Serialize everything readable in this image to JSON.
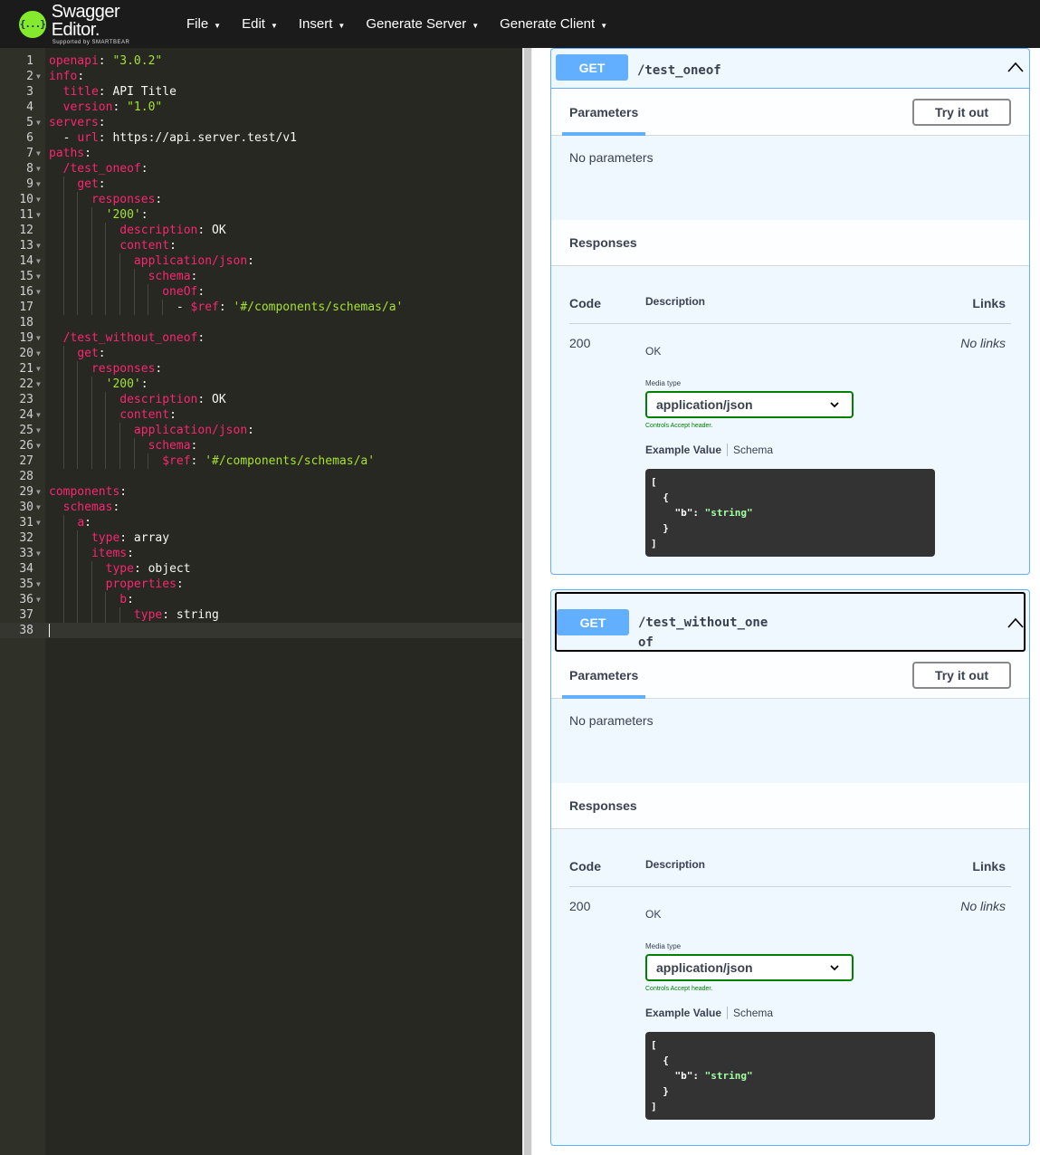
{
  "app": {
    "logo_title": "Swagger Editor.",
    "logo_subtitle": "Supported by SMARTBEAR",
    "logo_badge": "{...}"
  },
  "menu": [
    {
      "label": "File"
    },
    {
      "label": "Edit"
    },
    {
      "label": "Insert"
    },
    {
      "label": "Generate Server"
    },
    {
      "label": "Generate Client"
    }
  ],
  "editor": {
    "lines": [
      {
        "n": "1",
        "fold": false,
        "tokens": [
          [
            "k",
            "openapi"
          ],
          [
            "c",
            ": "
          ],
          [
            "s",
            "\"3.0.2\""
          ]
        ]
      },
      {
        "n": "2",
        "fold": true,
        "tokens": [
          [
            "k",
            "info"
          ],
          [
            "c",
            ":"
          ]
        ]
      },
      {
        "n": "3",
        "fold": false,
        "tokens": [
          [
            "c",
            "  "
          ],
          [
            "k",
            "title"
          ],
          [
            "c",
            ": API Title"
          ]
        ]
      },
      {
        "n": "4",
        "fold": false,
        "tokens": [
          [
            "c",
            "  "
          ],
          [
            "k",
            "version"
          ],
          [
            "c",
            ": "
          ],
          [
            "s",
            "\"1.0\""
          ]
        ]
      },
      {
        "n": "5",
        "fold": true,
        "tokens": [
          [
            "k",
            "servers"
          ],
          [
            "c",
            ":"
          ]
        ]
      },
      {
        "n": "6",
        "fold": false,
        "tokens": [
          [
            "c",
            "  - "
          ],
          [
            "k",
            "url"
          ],
          [
            "c",
            ": https://api.server.test/v1"
          ]
        ]
      },
      {
        "n": "7",
        "fold": true,
        "tokens": [
          [
            "k",
            "paths"
          ],
          [
            "c",
            ":"
          ]
        ]
      },
      {
        "n": "8",
        "fold": true,
        "tokens": [
          [
            "c",
            "  "
          ],
          [
            "k",
            "/test_oneof"
          ],
          [
            "c",
            ":"
          ]
        ]
      },
      {
        "n": "9",
        "fold": true,
        "tokens": [
          [
            "c",
            "    "
          ],
          [
            "k",
            "get"
          ],
          [
            "c",
            ":"
          ]
        ]
      },
      {
        "n": "10",
        "fold": true,
        "tokens": [
          [
            "c",
            "      "
          ],
          [
            "k",
            "responses"
          ],
          [
            "c",
            ":"
          ]
        ]
      },
      {
        "n": "11",
        "fold": true,
        "tokens": [
          [
            "c",
            "        "
          ],
          [
            "s",
            "'200'"
          ],
          [
            "c",
            ":"
          ]
        ]
      },
      {
        "n": "12",
        "fold": false,
        "tokens": [
          [
            "c",
            "          "
          ],
          [
            "k",
            "description"
          ],
          [
            "c",
            ": OK"
          ]
        ]
      },
      {
        "n": "13",
        "fold": true,
        "tokens": [
          [
            "c",
            "          "
          ],
          [
            "k",
            "content"
          ],
          [
            "c",
            ":"
          ]
        ]
      },
      {
        "n": "14",
        "fold": true,
        "tokens": [
          [
            "c",
            "            "
          ],
          [
            "k",
            "application/json"
          ],
          [
            "c",
            ":"
          ]
        ]
      },
      {
        "n": "15",
        "fold": true,
        "tokens": [
          [
            "c",
            "              "
          ],
          [
            "k",
            "schema"
          ],
          [
            "c",
            ":"
          ]
        ]
      },
      {
        "n": "16",
        "fold": true,
        "tokens": [
          [
            "c",
            "                "
          ],
          [
            "k",
            "oneOf"
          ],
          [
            "c",
            ":"
          ]
        ]
      },
      {
        "n": "17",
        "fold": false,
        "tokens": [
          [
            "c",
            "                  - "
          ],
          [
            "k",
            "$ref"
          ],
          [
            "c",
            ": "
          ],
          [
            "s",
            "'#/components/schemas/a'"
          ]
        ]
      },
      {
        "n": "18",
        "fold": false,
        "tokens": []
      },
      {
        "n": "19",
        "fold": true,
        "tokens": [
          [
            "c",
            "  "
          ],
          [
            "k",
            "/test_without_oneof"
          ],
          [
            "c",
            ":"
          ]
        ]
      },
      {
        "n": "20",
        "fold": true,
        "tokens": [
          [
            "c",
            "    "
          ],
          [
            "k",
            "get"
          ],
          [
            "c",
            ":"
          ]
        ]
      },
      {
        "n": "21",
        "fold": true,
        "tokens": [
          [
            "c",
            "      "
          ],
          [
            "k",
            "responses"
          ],
          [
            "c",
            ":"
          ]
        ]
      },
      {
        "n": "22",
        "fold": true,
        "tokens": [
          [
            "c",
            "        "
          ],
          [
            "s",
            "'200'"
          ],
          [
            "c",
            ":"
          ]
        ]
      },
      {
        "n": "23",
        "fold": false,
        "tokens": [
          [
            "c",
            "          "
          ],
          [
            "k",
            "description"
          ],
          [
            "c",
            ": OK"
          ]
        ]
      },
      {
        "n": "24",
        "fold": true,
        "tokens": [
          [
            "c",
            "          "
          ],
          [
            "k",
            "content"
          ],
          [
            "c",
            ":"
          ]
        ]
      },
      {
        "n": "25",
        "fold": true,
        "tokens": [
          [
            "c",
            "            "
          ],
          [
            "k",
            "application/json"
          ],
          [
            "c",
            ":"
          ]
        ]
      },
      {
        "n": "26",
        "fold": true,
        "tokens": [
          [
            "c",
            "              "
          ],
          [
            "k",
            "schema"
          ],
          [
            "c",
            ":"
          ]
        ]
      },
      {
        "n": "27",
        "fold": false,
        "tokens": [
          [
            "c",
            "                "
          ],
          [
            "k",
            "$ref"
          ],
          [
            "c",
            ": "
          ],
          [
            "s",
            "'#/components/schemas/a'"
          ]
        ]
      },
      {
        "n": "28",
        "fold": false,
        "tokens": []
      },
      {
        "n": "29",
        "fold": true,
        "tokens": [
          [
            "k",
            "components"
          ],
          [
            "c",
            ":"
          ]
        ]
      },
      {
        "n": "30",
        "fold": true,
        "tokens": [
          [
            "c",
            "  "
          ],
          [
            "k",
            "schemas"
          ],
          [
            "c",
            ":"
          ]
        ]
      },
      {
        "n": "31",
        "fold": true,
        "tokens": [
          [
            "c",
            "    "
          ],
          [
            "k",
            "a"
          ],
          [
            "c",
            ":"
          ]
        ]
      },
      {
        "n": "32",
        "fold": false,
        "tokens": [
          [
            "c",
            "      "
          ],
          [
            "k",
            "type"
          ],
          [
            "c",
            ": array"
          ]
        ]
      },
      {
        "n": "33",
        "fold": true,
        "tokens": [
          [
            "c",
            "      "
          ],
          [
            "k",
            "items"
          ],
          [
            "c",
            ":"
          ]
        ]
      },
      {
        "n": "34",
        "fold": false,
        "tokens": [
          [
            "c",
            "        "
          ],
          [
            "k",
            "type"
          ],
          [
            "c",
            ": object"
          ]
        ]
      },
      {
        "n": "35",
        "fold": true,
        "tokens": [
          [
            "c",
            "        "
          ],
          [
            "k",
            "properties"
          ],
          [
            "c",
            ":"
          ]
        ]
      },
      {
        "n": "36",
        "fold": true,
        "tokens": [
          [
            "c",
            "          "
          ],
          [
            "k",
            "b"
          ],
          [
            "c",
            ":"
          ]
        ]
      },
      {
        "n": "37",
        "fold": false,
        "tokens": [
          [
            "c",
            "            "
          ],
          [
            "k",
            "type"
          ],
          [
            "c",
            ": string"
          ]
        ]
      },
      {
        "n": "38",
        "fold": false,
        "tokens": [],
        "active": true
      }
    ]
  },
  "operations": [
    {
      "method": "GET",
      "path": "/test_oneof",
      "parameters_tab": "Parameters",
      "try_button": "Try it out",
      "no_params": "No parameters",
      "responses_title": "Responses",
      "col_code": "Code",
      "col_description": "Description",
      "col_links": "Links",
      "code": "200",
      "description": "OK",
      "links": "No links",
      "media_type_label": "Media type",
      "media_type_value": "application/json",
      "controls_label": "Controls Accept header.",
      "example_tab": "Example Value",
      "schema_tab": "Schema",
      "example_lines": [
        [
          "[",
          ""
        ],
        [
          "  {",
          ""
        ],
        [
          "    \"b\": ",
          "\"string\""
        ],
        [
          "  }",
          ""
        ],
        [
          "]",
          ""
        ]
      ]
    },
    {
      "method": "GET",
      "path": "/test_without_oneof",
      "parameters_tab": "Parameters",
      "try_button": "Try it out",
      "no_params": "No parameters",
      "responses_title": "Responses",
      "col_code": "Code",
      "col_description": "Description",
      "col_links": "Links",
      "code": "200",
      "description": "OK",
      "links": "No links",
      "media_type_label": "Media type",
      "media_type_value": "application/json",
      "controls_label": "Controls Accept header.",
      "example_tab": "Example Value",
      "schema_tab": "Schema",
      "example_lines": [
        [
          "[",
          ""
        ],
        [
          "  {",
          ""
        ],
        [
          "    \"b\": ",
          "\"string\""
        ],
        [
          "  }",
          ""
        ],
        [
          "]",
          ""
        ]
      ]
    }
  ],
  "colors": {
    "topbar": "#1b1b1b",
    "logo_green": "#85ea2d",
    "editor_bg": "#272822",
    "yaml_key": "#f92672",
    "yaml_string": "#a6e22e",
    "get_method": "#61affe",
    "media_select_border": "#008000"
  }
}
